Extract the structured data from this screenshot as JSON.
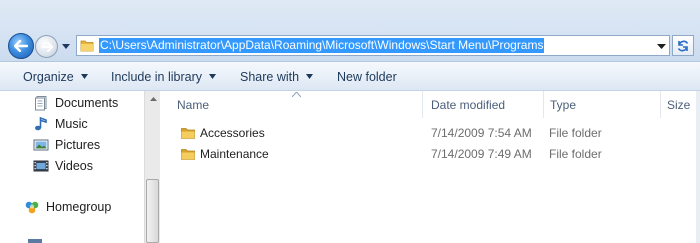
{
  "address_bar": {
    "path": "C:\\Users\\Administrator\\AppData\\Roaming\\Microsoft\\Windows\\Start Menu\\Programs"
  },
  "toolbar": {
    "organize_label": "Organize",
    "include_label": "Include in library",
    "share_label": "Share with",
    "new_folder_label": "New folder"
  },
  "nav_pane": {
    "items": [
      {
        "label": "Documents",
        "icon": "documents-icon"
      },
      {
        "label": "Music",
        "icon": "music-icon"
      },
      {
        "label": "Pictures",
        "icon": "pictures-icon"
      },
      {
        "label": "Videos",
        "icon": "videos-icon"
      }
    ],
    "homegroup_label": "Homegroup"
  },
  "columns": {
    "name": "Name",
    "date_modified": "Date modified",
    "type": "Type",
    "size": "Size"
  },
  "files": [
    {
      "name": "Accessories",
      "date_modified": "7/14/2009 7:54 AM",
      "type": "File folder"
    },
    {
      "name": "Maintenance",
      "date_modified": "7/14/2009 7:49 AM",
      "type": "File folder"
    }
  ],
  "colors": {
    "selection": "#3399ff",
    "toolbar_text": "#1e395b",
    "folder": "#e8b53c"
  }
}
